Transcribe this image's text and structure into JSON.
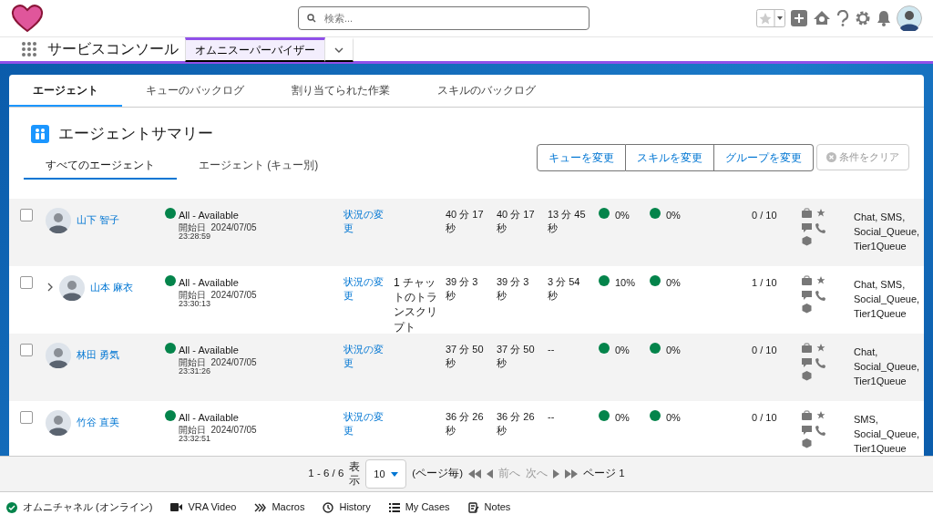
{
  "header": {
    "search": {
      "placeholder": "検索..."
    }
  },
  "nav": {
    "app_title": "サービスコンソール",
    "tabs": [
      {
        "label": "オムニスーパーバイザー",
        "selected": true
      }
    ]
  },
  "page_tabs": [
    {
      "label": "エージェント",
      "selected": true
    },
    {
      "label": "キューのバックログ",
      "selected": false
    },
    {
      "label": "割り当てられた作業",
      "selected": false
    },
    {
      "label": "スキルのバックログ",
      "selected": false
    }
  ],
  "summary": {
    "title": "エージェントサマリー",
    "sub_tabs": [
      {
        "label": "すべてのエージェント",
        "selected": true
      },
      {
        "label": "エージェント (キュー別)",
        "selected": false
      }
    ],
    "buttons": [
      {
        "label": "キューを変更",
        "disabled": false
      },
      {
        "label": "スキルを変更",
        "disabled": false
      },
      {
        "label": "グループを変更",
        "disabled": false
      }
    ],
    "clear_button": {
      "label": "条件をクリア",
      "disabled": true
    }
  },
  "rows": [
    {
      "checked": false,
      "expandable": false,
      "name": "山下 智子",
      "status": "All - Available",
      "color": "#04844b",
      "since": "開始日  2024/07/05",
      "since_time": "23:28:59",
      "action": "状況の変更",
      "work": "",
      "time_1": "40 分 17 秒",
      "time_2": "40 分 17 秒",
      "time_3": "13 分 45 秒",
      "pct_1": "0%",
      "pct_2": "0%",
      "capacity": "0 / 10",
      "queues": "Chat, SMS, Social_Queue, Tier1Queue"
    },
    {
      "checked": false,
      "expandable": true,
      "name": "山本 麻衣",
      "status": "All - Available",
      "color": "#04844b",
      "since": "開始日  2024/07/05",
      "since_time": "23:30:13",
      "action": "状況の変更",
      "work": "1 チャットのトランスクリプト",
      "time_1": "39 分 3 秒",
      "time_2": "39 分 3 秒",
      "time_3": "3 分 54 秒",
      "pct_1": "10%",
      "pct_2": "0%",
      "capacity": "1 / 10",
      "queues": "Chat, SMS, Social_Queue, Tier1Queue"
    },
    {
      "checked": false,
      "expandable": false,
      "name": "林田 勇気",
      "status": "All - Available",
      "color": "#04844b",
      "since": "開始日  2024/07/05",
      "since_time": "23:31:26",
      "action": "状況の変更",
      "work": "",
      "time_1": "37 分 50 秒",
      "time_2": "37 分 50 秒",
      "time_3": "--",
      "pct_1": "0%",
      "pct_2": "0%",
      "capacity": "0 / 10",
      "queues": "Chat, Social_Queue, Tier1Queue"
    },
    {
      "checked": false,
      "expandable": false,
      "name": "竹谷 直美",
      "status": "All - Available",
      "color": "#04844b",
      "since": "開始日  2024/07/05",
      "since_time": "23:32:51",
      "action": "状況の変更",
      "work": "",
      "time_1": "36 分 26 秒",
      "time_2": "36 分 26 秒",
      "time_3": "--",
      "pct_1": "0%",
      "pct_2": "0%",
      "capacity": "0 / 10",
      "queues": "SMS, Social_Queue, Tier1Queue"
    }
  ],
  "pagination": {
    "range": "1 - 6 / 6",
    "show_label": "表示",
    "page_size": "10",
    "per_page": "(ページ毎)",
    "prev": {
      "label": "前へ",
      "disabled": true
    },
    "next": {
      "label": "次へ",
      "disabled": true
    },
    "page": "ページ 1"
  },
  "utility_bar": [
    {
      "kind": "status",
      "label": "オムニチャネル (オンライン)"
    },
    {
      "kind": "video",
      "label": "VRA Video"
    },
    {
      "kind": "macros",
      "label": "Macros"
    },
    {
      "kind": "history",
      "label": "History"
    },
    {
      "kind": "list",
      "label": "My Cases"
    },
    {
      "kind": "notes",
      "label": "Notes"
    }
  ]
}
